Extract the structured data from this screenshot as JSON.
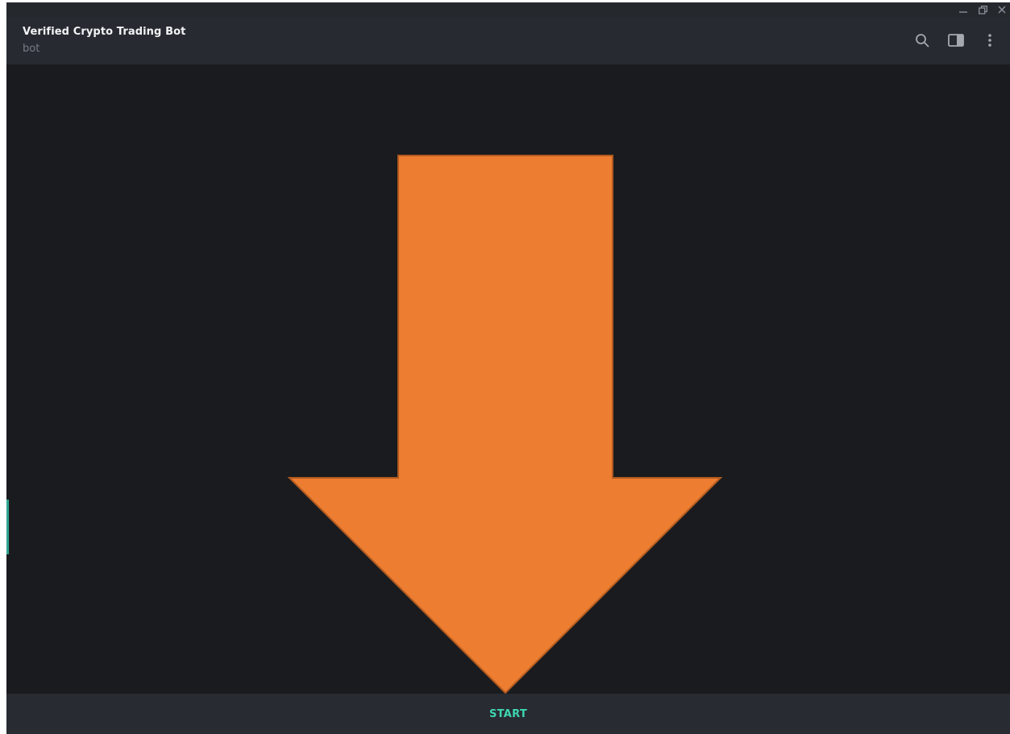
{
  "header": {
    "title": "Verified Crypto Trading Bot",
    "subtitle": "bot"
  },
  "icons": {
    "minimize": "minimize-icon",
    "restore": "restore-icon",
    "close": "close-icon",
    "search": "search-icon",
    "sidebar": "sidebar-toggle-icon",
    "menu": "more-vertical-icon",
    "arrow": "down-arrow-graphic"
  },
  "colors": {
    "background": "#1a1b1e",
    "header": "#272a31",
    "arrow_fill": "#ed7d31",
    "arrow_stroke": "#b05a1f",
    "accent": "#3ed6b0"
  },
  "bottom_bar": {
    "start_label": "START"
  }
}
